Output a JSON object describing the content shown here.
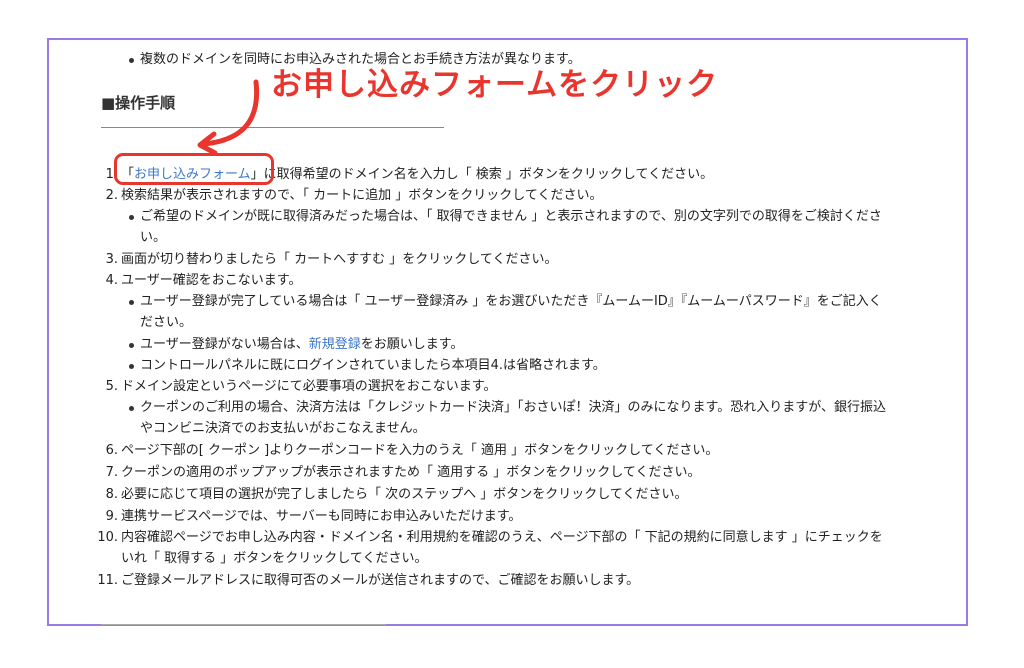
{
  "annotation": {
    "callout": "お申し込みフォームをクリック",
    "accent_color": "#e8362e"
  },
  "intro_bullet": "複数のドメインを同時にお申込みされた場合とお手続き方法が異なります。",
  "heading": "■操作手順",
  "steps": [
    {
      "num": "1.",
      "pre": "「",
      "link": "お申し込みフォーム",
      "post": "」に取得希望のドメイン名を入力し「 検索 」ボタンをクリックしてください。"
    },
    {
      "num": "2.",
      "text": "検索結果が表示されますので、「 カートに追加 」ボタンをクリックしてください。",
      "sub": [
        {
          "line1": "ご希望のドメインが既に取得済みだった場合は、「 取得できません 」と表示されますので、別の文字列での取得をご検討くださ",
          "line2": "い。"
        }
      ]
    },
    {
      "num": "3.",
      "text": "画面が切り替わりましたら「 カートへすすむ 」をクリックしてください。"
    },
    {
      "num": "4.",
      "text": "ユーザー確認をおこないます。",
      "sub": [
        {
          "line1": "ユーザー登録が完了している場合は「 ユーザー登録済み 」をお選びいただき『ムームーID』『ムームーパスワード』をご記入く",
          "line2": "ださい。"
        },
        {
          "pre": "ユーザー登録がない場合は、",
          "link": "新規登録",
          "post": "をお願いします。"
        },
        {
          "line1": "コントロールパネルに既にログインされていましたら本項目4.は省略されます。"
        }
      ]
    },
    {
      "num": "5.",
      "text": "ドメイン設定というページにて必要事項の選択をおこないます。",
      "sub": [
        {
          "line1": "クーポンのご利用の場合、決済方法は「クレジットカード決済」「おさいぽ！決済」のみになります。恐れ入りますが、銀行振込",
          "line2": "やコンビニ決済でのお支払いがおこなえません。"
        }
      ]
    },
    {
      "num": "6.",
      "text": "ページ下部の[ クーポン ]よりクーポンコードを入力のうえ「 適用 」ボタンをクリックしてください。"
    },
    {
      "num": "7.",
      "text": "クーポンの適用のポップアップが表示されますため「 適用する 」ボタンをクリックしてください。"
    },
    {
      "num": "8.",
      "text": "必要に応じて項目の選択が完了しましたら「 次のステップへ 」ボタンをクリックしてください。"
    },
    {
      "num": "9.",
      "text": "連携サービスページでは、サーバーも同時にお申込みいただけます。"
    },
    {
      "num": "10.",
      "text": "内容確認ページでお申し込み内容・ドメイン名・利用規約を確認のうえ、ページ下部の「 下記の規約に同意します 」にチェックを",
      "text2": "いれ「 取得する 」ボタンをクリックしてください。"
    },
    {
      "num": "11.",
      "text": "ご登録メールアドレスに取得可否のメールが送信されますので、ご確認をお願いします。"
    }
  ]
}
